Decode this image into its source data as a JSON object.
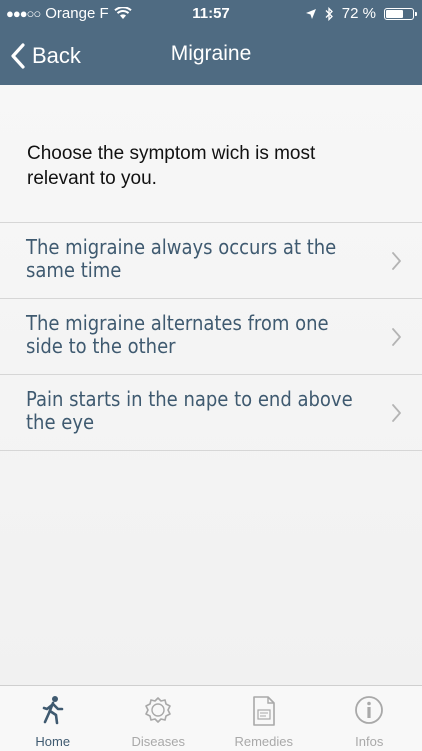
{
  "status_bar": {
    "carrier": "Orange F",
    "time": "11:57",
    "battery_percent_label": "72 %",
    "battery_level": 0.72
  },
  "nav": {
    "back_label": "Back",
    "title": "Migraine"
  },
  "prompt": "Choose the symptom wich is most relevant to you.",
  "symptoms": [
    {
      "label": "The migraine always occurs at the same time"
    },
    {
      "label": "The migraine alternates from one side to the other"
    },
    {
      "label": "Pain starts in the nape to end above the eye"
    }
  ],
  "tabs": [
    {
      "label": "Home",
      "icon": "walking-person-icon",
      "active": true
    },
    {
      "label": "Diseases",
      "icon": "virus-icon",
      "active": false
    },
    {
      "label": "Remedies",
      "icon": "document-icon",
      "active": false
    },
    {
      "label": "Infos",
      "icon": "info-circle-icon",
      "active": false
    }
  ],
  "colors": {
    "header": "#4f6b82",
    "accent_text": "#3f5a70",
    "inactive_tab": "#a9a9a9"
  }
}
